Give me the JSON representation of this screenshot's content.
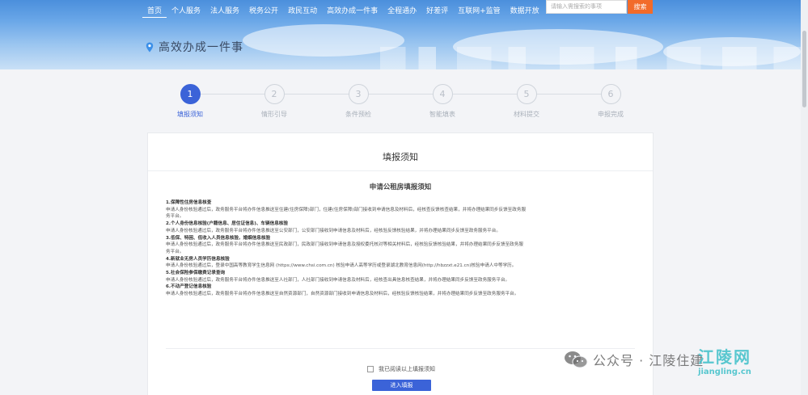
{
  "header": {
    "nav": [
      "首页",
      "个人服务",
      "法人服务",
      "税务公开",
      "政民互动",
      "高效办成一件事",
      "全程通办",
      "好差评",
      "互联网+监管",
      "数据开放"
    ],
    "active_nav_index": 0,
    "search": {
      "placeholder": "请输入需搜索的事项",
      "button_label": "搜索"
    },
    "page_title": "高效办成一件事"
  },
  "steps": [
    {
      "number": "1",
      "label": "填报须知",
      "active": true
    },
    {
      "number": "2",
      "label": "情形引导",
      "active": false
    },
    {
      "number": "3",
      "label": "条件预检",
      "active": false
    },
    {
      "number": "4",
      "label": "智能填表",
      "active": false
    },
    {
      "number": "5",
      "label": "材料提交",
      "active": false
    },
    {
      "number": "6",
      "label": "申报完成",
      "active": false
    }
  ],
  "card": {
    "title": "填报须知",
    "notice_title": "申请公租房填报须知",
    "lines": [
      {
        "text": "1.保障性住房信息核查",
        "heading": true
      },
      {
        "text": "申请人身份核验通过后，政务服务平台将办件信息推送至住建(住房保障)部门，住建(住房保障)部门接收到申请信息及材料后，经核查反馈核查结果，并将办理结果同步反馈至政务服",
        "heading": false
      },
      {
        "text": "务平台。",
        "heading": false
      },
      {
        "text": "2.个人身份信息核验(户籍信息、居住证信息)、车辆信息核验",
        "heading": true
      },
      {
        "text": "申请人身份核验通过后，政务服务平台将办件信息推送至公安部门，公安部门接收到申请信息及材料后，经核验反馈核验结果，并将办理结果同步反馈至政务服务平台。",
        "heading": false
      },
      {
        "text": "3.低保、特困、低收入人员信息核验，婚姻信息核验",
        "heading": true
      },
      {
        "text": "申请人身份核验通过后，政务服务平台将办件信息推送至民政部门，民政部门接收到申请信息及授权委托核对等相关材料后，经核验反馈核验结果，并将办理结果同步反馈至政务服",
        "heading": false
      },
      {
        "text": "务平台。",
        "heading": false
      },
      {
        "text": "4.新就业无房人员学历信息核验",
        "heading": true
      },
      {
        "text": "申请人身份核验通过后，登录中国高等教育学生信息网 (https://www.chsi.com.cn) 核验申请人高等学历或登录湖北教育信息网(http://hbzzxt.e21.cn)核验申请人中等学历。",
        "heading": false
      },
      {
        "text": "5.社会保险参保缴费记录查询",
        "heading": true
      },
      {
        "text": "申请人身份核验通过后，政务服务平台将办件信息推送至人社部门，人社部门接收到申请信息及材料后，经核查出具信息核查结果，并将办理结果同步反馈至政务服务平台。",
        "heading": false
      },
      {
        "text": "6.不动产登记信息核验",
        "heading": true
      },
      {
        "text": "申请人身份核验通过后，政务服务平台将办件信息推送至自然资源部门，自然资源部门接收到申请信息及材料后，经核验反馈核验结果，并将办理结果同步反馈至政务服务平台。",
        "heading": false
      }
    ],
    "agree_label": "我已阅读以上填报须知",
    "enter_button": "进入填报"
  },
  "watermark": {
    "wechat_text": "公众号 · 江陵住建",
    "site_cn": "江陵网",
    "site_url": "jiangling.cn"
  },
  "colors": {
    "accent": "#3b63d8",
    "search_button": "#f26b2a"
  }
}
